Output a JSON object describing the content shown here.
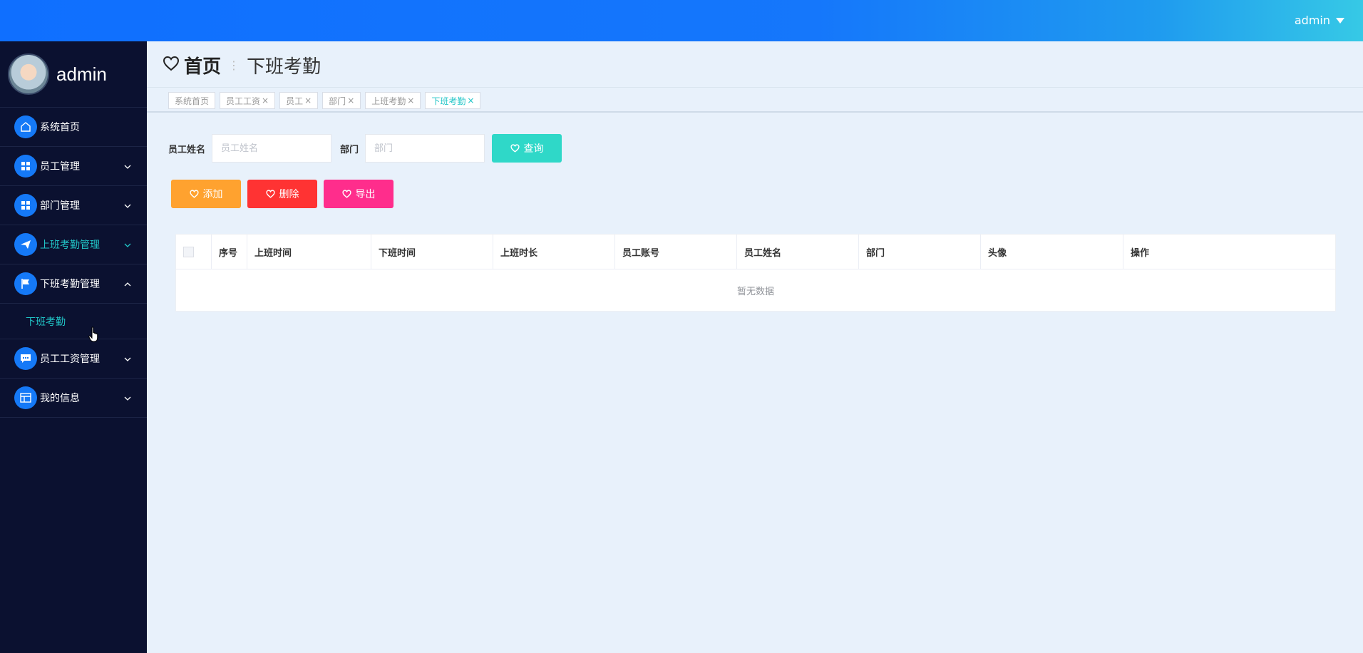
{
  "header": {
    "user": "admin"
  },
  "sidebar": {
    "profile_name": "admin",
    "items": [
      {
        "label": "系统首页",
        "icon": "home-icon",
        "chevron": ""
      },
      {
        "label": "员工管理",
        "icon": "grid-icon",
        "chevron": "down"
      },
      {
        "label": "部门管理",
        "icon": "grid-icon",
        "chevron": "down"
      },
      {
        "label": "上班考勤管理",
        "icon": "send-icon",
        "chevron": "down"
      },
      {
        "label": "下班考勤管理",
        "icon": "flag-icon",
        "chevron": "up"
      },
      {
        "label": "员工工资管理",
        "icon": "chat-icon",
        "chevron": "down"
      },
      {
        "label": "我的信息",
        "icon": "browser-icon",
        "chevron": "down"
      }
    ],
    "subitem": "下班考勤"
  },
  "breadcrumb": {
    "home": "首页",
    "current": "下班考勤"
  },
  "tabs": [
    {
      "label": "系统首页"
    },
    {
      "label": "员工工资",
      "closable": true
    },
    {
      "label": "员工",
      "closable": true
    },
    {
      "label": "部门",
      "closable": true
    },
    {
      "label": "上班考勤",
      "closable": true
    },
    {
      "label": "下班考勤",
      "closable": true,
      "active": true
    }
  ],
  "search": {
    "name_label": "员工姓名",
    "name_placeholder": "员工姓名",
    "dept_label": "部门",
    "dept_placeholder": "部门",
    "query_button": "查询"
  },
  "actions": {
    "add": "添加",
    "delete": "删除",
    "export": "导出"
  },
  "table": {
    "columns": [
      "序号",
      "上班时间",
      "下班时间",
      "上班时长",
      "员工账号",
      "员工姓名",
      "部门",
      "头像",
      "操作"
    ],
    "empty_text": "暂无数据"
  },
  "colors": {
    "accent": "#21c5c7",
    "primary": "#1579f7",
    "sidebar_bg": "#0b1130",
    "btn_search": "#2fd8c8",
    "btn_add": "#ffa22f",
    "btn_delete": "#ff3333",
    "btn_export": "#ff2d8c"
  }
}
